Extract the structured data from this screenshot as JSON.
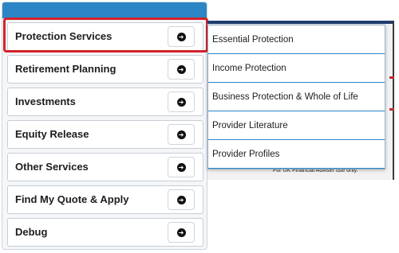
{
  "menu": {
    "items": [
      {
        "label": "Protection Services"
      },
      {
        "label": "Retirement Planning"
      },
      {
        "label": "Investments"
      },
      {
        "label": "Equity Release"
      },
      {
        "label": "Other Services"
      },
      {
        "label": "Find My Quote & Apply"
      },
      {
        "label": "Debug"
      }
    ],
    "arrow_icon": "arrow-right-circle-icon"
  },
  "submenu": {
    "items": [
      {
        "label": "Essential Protection"
      },
      {
        "label": "Income Protection"
      },
      {
        "label": "Business Protection & Whole of Life"
      },
      {
        "label": "Provider Literature"
      },
      {
        "label": "Provider Profiles"
      }
    ]
  },
  "background": {
    "disclaimer": "For UK Financial Adviser use only."
  },
  "colors": {
    "header": "#2c86c6",
    "highlight": "#d3232a",
    "submenu_divider": "#2c86c6"
  }
}
